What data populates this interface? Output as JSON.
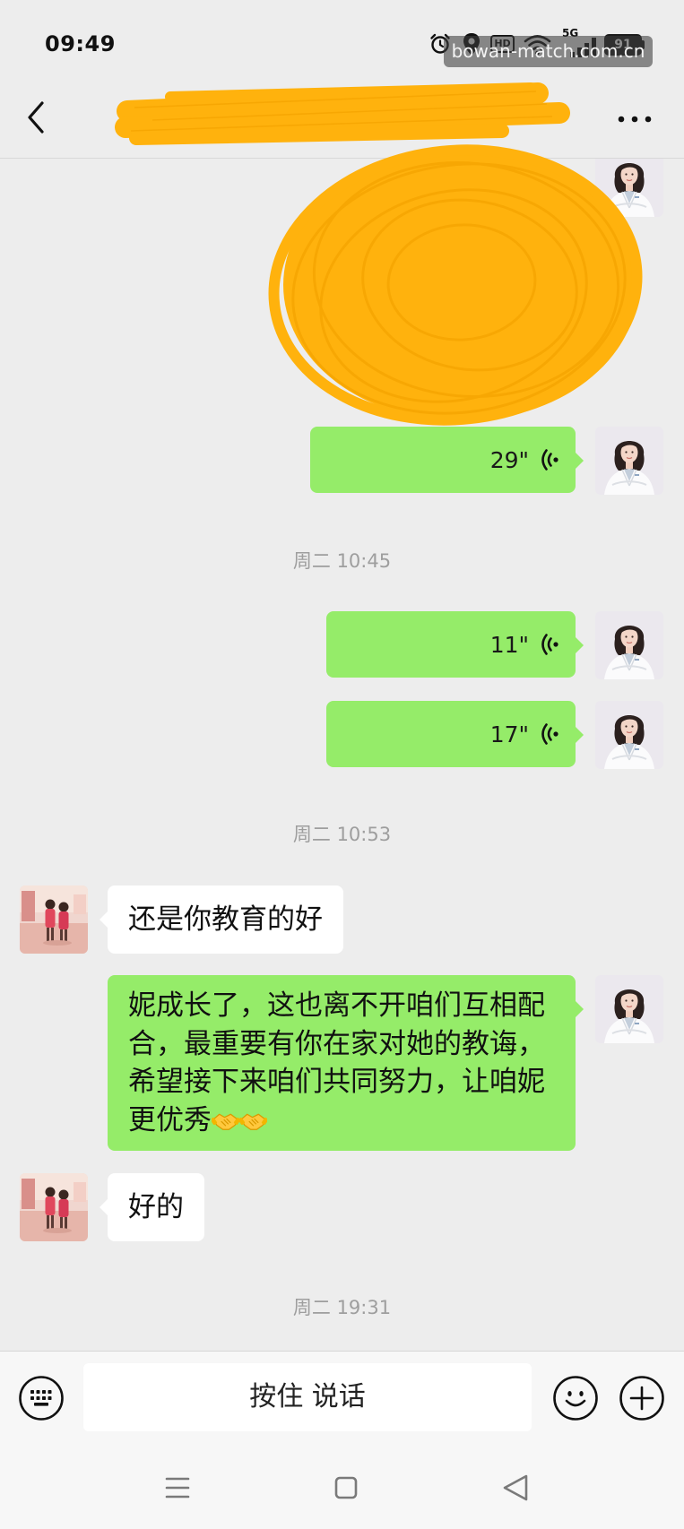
{
  "status_bar": {
    "time": "09:49",
    "hd_label": "HD",
    "network_type": "5G",
    "battery_level": "91",
    "icons": [
      "alarm-icon",
      "location-icon",
      "wifi-icon",
      "signal-icon",
      "battery-icon"
    ]
  },
  "watermark": "bowan-match.com.cn",
  "header": {
    "icons": [
      "back-icon",
      "more-icon"
    ]
  },
  "messages": [
    {
      "sent_voice_duration": "29\""
    },
    {
      "timestamp": "周二 10:45"
    },
    {
      "sent_voice_duration": "11\""
    },
    {
      "sent_voice_duration": "17\""
    },
    {
      "timestamp": "周二 10:53"
    },
    {
      "received_text": "还是你教育的好"
    },
    {
      "sent_text": "妮成长了，这也离不开咱们互相配合，最重要有你在家对她的教诲，希望接下来咱们共同努力，让咱妮更优秀",
      "trailing_icons": [
        "handshake-icon",
        "handshake-icon"
      ]
    },
    {
      "received_text": "好的"
    },
    {
      "timestamp": "周二 19:31"
    }
  ],
  "input_bar": {
    "hold_to_talk_label": "按住 说话",
    "icons": [
      "keyboard-icon",
      "emoji-icon",
      "plus-icon"
    ]
  },
  "nav_bar": {
    "icons": [
      "menu-icon",
      "home-icon",
      "nav-back-icon"
    ]
  },
  "colors": {
    "chat_background": "#ededed",
    "sent_bubble": "#95ec69",
    "received_bubble": "#ffffff",
    "timestamp_text": "#9e9e9e",
    "input_bar_background": "#f7f7f7",
    "redaction_scribble": "#ffb20d",
    "watermark_background": "rgba(60,60,60,0.58)"
  }
}
